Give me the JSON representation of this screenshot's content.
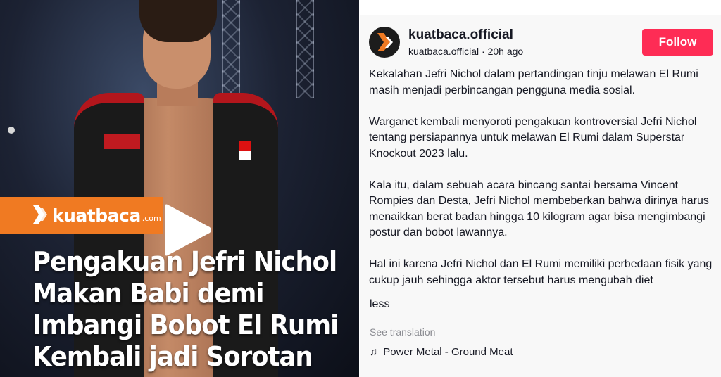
{
  "video": {
    "brand": {
      "name": "kuatbaca",
      "suffix": ".com",
      "color": "#f07a22"
    },
    "headline_lines": [
      "Pengakuan Jefri Nichol",
      "Makan Babi demi",
      "Imbangi Bobot El Rumi",
      "Kembali jadi Sorotan"
    ],
    "play_icon": "play-icon"
  },
  "post": {
    "username": "kuatbaca.official",
    "meta": "kuatbaca.official · 20h ago",
    "follow_label": "Follow",
    "follow_color": "#fe2c55",
    "caption": [
      "Kekalahan Jefri Nichol dalam pertandingan tinju melawan El Rumi masih menjadi perbincangan pengguna media sosial.",
      "Warganet kembali menyoroti pengakuan kontroversial Jefri Nichol tentang persiapannya untuk melawan El Rumi dalam Superstar Knockout 2023 lalu.",
      "Kala itu, dalam sebuah acara bincang santai bersama Vincent Rompies dan Desta, Jefri Nichol membeberkan bahwa dirinya harus menaikkan berat badan hingga 10 kilogram agar bisa mengimbangi postur dan bobot lawannya.",
      "Hal ini karena Jefri Nichol dan El Rumi memiliki perbedaan fisik yang cukup jauh sehingga aktor tersebut harus mengubah diet"
    ],
    "less_label": "less",
    "translation_label": "See translation",
    "music": {
      "icon": "music-note-icon",
      "glyph": "♫",
      "title": "Power Metal - Ground Meat"
    }
  }
}
